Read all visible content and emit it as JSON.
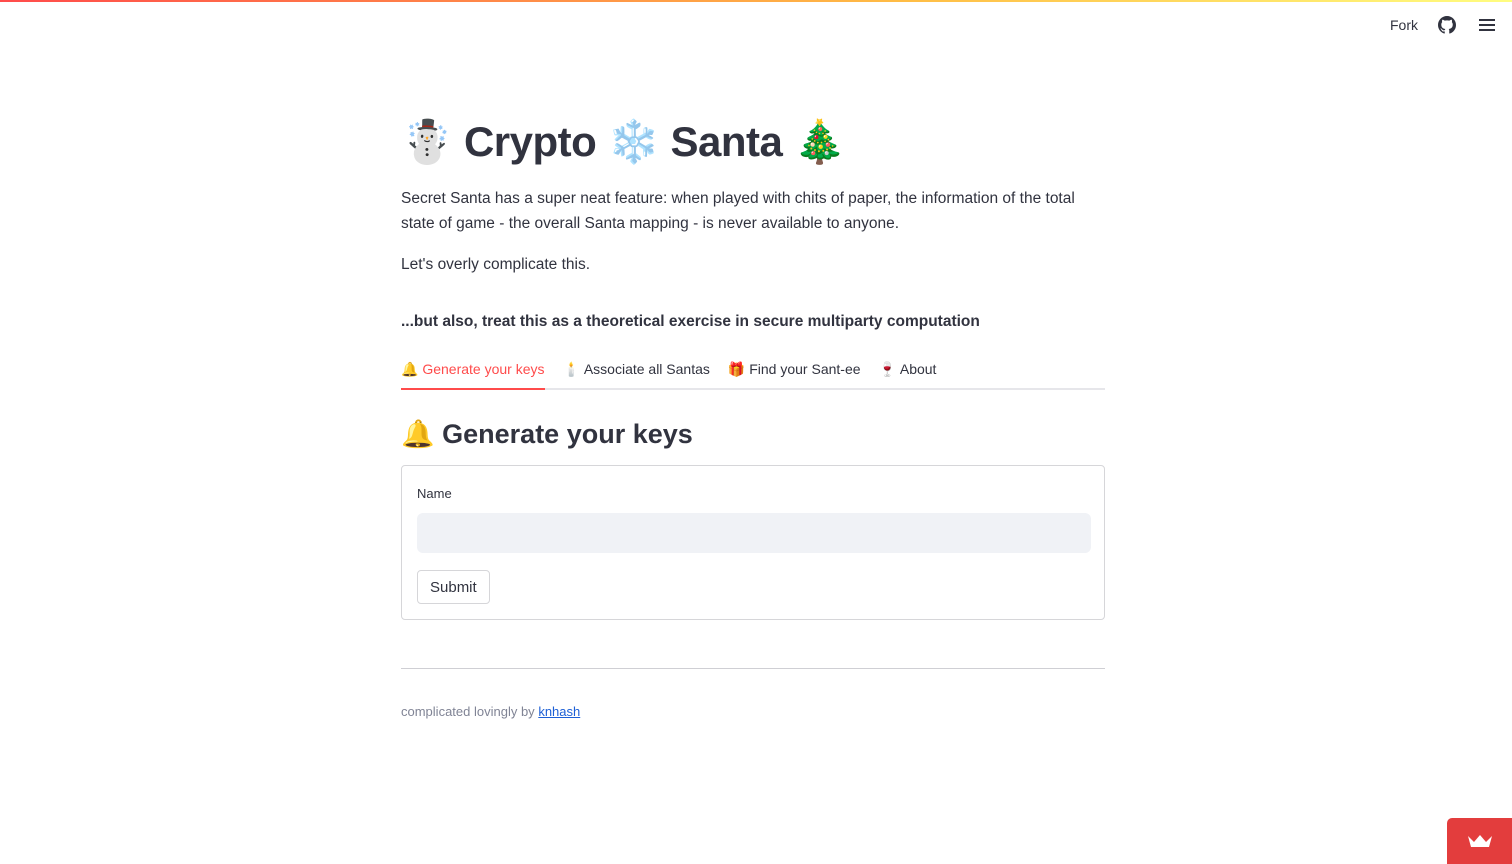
{
  "header": {
    "fork_label": "Fork",
    "github_icon": "github-icon",
    "menu_icon": "hamburger-menu-icon"
  },
  "title": {
    "emoji_left": "☃️",
    "word1": "Crypto",
    "emoji_mid": "❄️",
    "word2": "Santa",
    "emoji_right": "🎄"
  },
  "intro": {
    "paragraph1": "Secret Santa has a super neat feature: when played with chits of paper, the information of the total state of game - the overall Santa mapping - is never available to anyone.",
    "paragraph2": "Let's overly complicate this.",
    "bold_note": "...but also, treat this as a theoretical exercise in secure multiparty computation"
  },
  "tabs": [
    {
      "emoji": "🔔",
      "label": "Generate your keys",
      "active": true
    },
    {
      "emoji": "🕯️",
      "label": "Associate all Santas",
      "active": false
    },
    {
      "emoji": "🎁",
      "label": "Find your Sant-ee",
      "active": false
    },
    {
      "emoji": "🍷",
      "label": "About",
      "active": false
    }
  ],
  "section": {
    "emoji": "🔔",
    "title": "Generate your keys"
  },
  "form": {
    "name_label": "Name",
    "name_value": "",
    "submit_label": "Submit"
  },
  "footer": {
    "prefix": "complicated lovingly by",
    "link_text": "knhash"
  },
  "colors": {
    "accent": "#ff4b4b",
    "link": "#1c5fd6",
    "badge": "#e33d3d"
  }
}
